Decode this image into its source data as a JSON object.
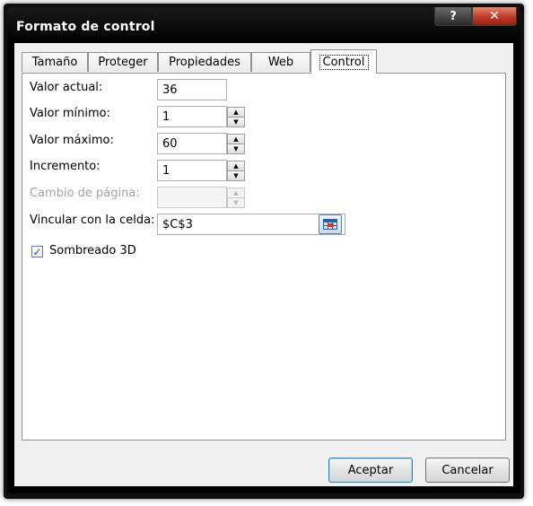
{
  "window": {
    "title": "Formato de control",
    "help_label": "?",
    "close_label": "✕"
  },
  "tabs": [
    {
      "label": "Tamaño"
    },
    {
      "label": "Proteger"
    },
    {
      "label": "Propiedades"
    },
    {
      "label": "Web"
    },
    {
      "label": "Control",
      "active": true
    }
  ],
  "fields": {
    "valor_actual": {
      "label": "Valor actual:",
      "value": "36"
    },
    "valor_minimo": {
      "label": "Valor mínimo:",
      "value": "1"
    },
    "valor_maximo": {
      "label": "Valor máximo:",
      "value": "60"
    },
    "incremento": {
      "label": "Incremento:",
      "value": "1"
    },
    "cambio_pagina": {
      "label": "Cambio de página:",
      "value": "",
      "disabled": true
    },
    "vincular_celda": {
      "label": "Vincular con la celda:",
      "value": "$C$3"
    }
  },
  "checkbox": {
    "label": "Sombreado 3D",
    "checked": true,
    "check_glyph": "✓"
  },
  "buttons": {
    "ok_label": "Aceptar",
    "cancel_label": "Cancelar"
  },
  "icons": {
    "spin_up": "▲",
    "spin_down": "▼",
    "cell_reference": "cell-reference-icon",
    "mouse_cursor": "mouse-pointer-icon"
  },
  "colors": {
    "titlebar": "#000000",
    "client_bg": "#f0f0f0",
    "panel_bg": "#ffffff",
    "disabled_text": "#a0a0a0",
    "close_button": "#c0402a"
  }
}
